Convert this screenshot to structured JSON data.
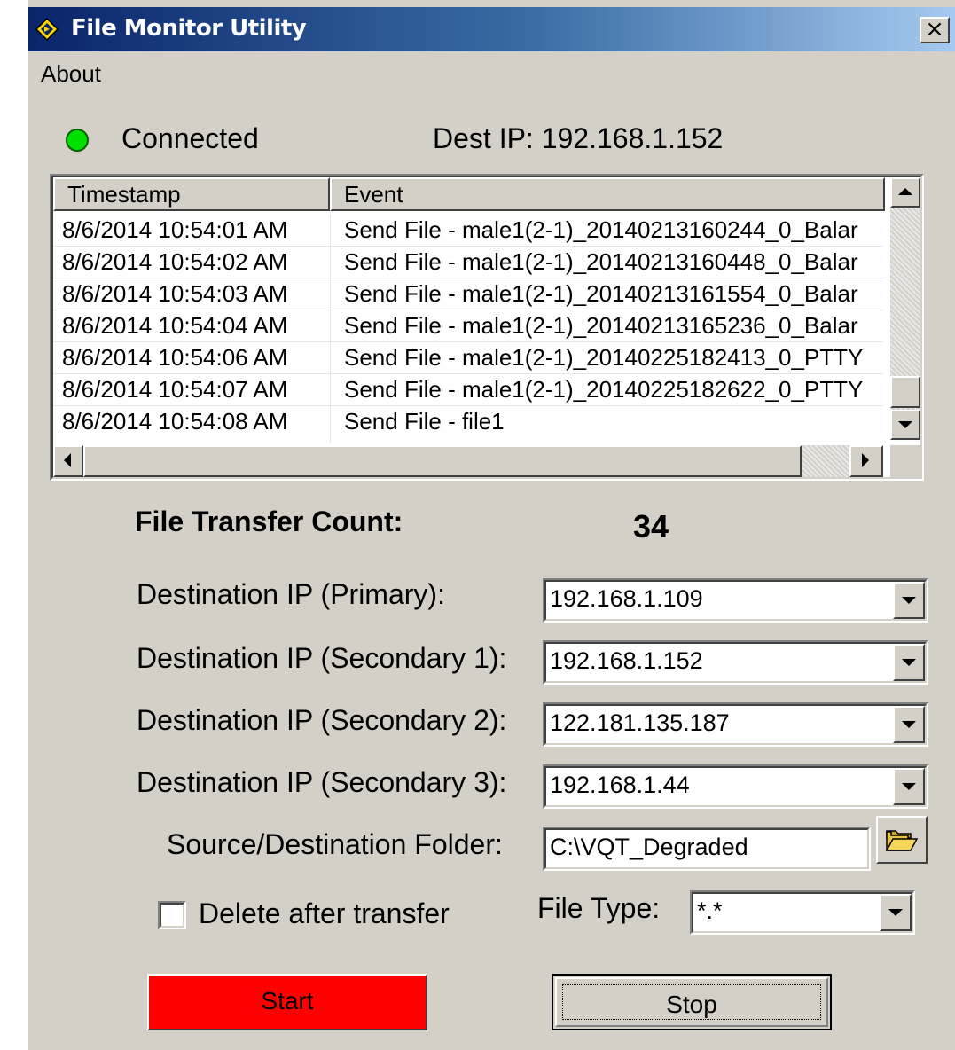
{
  "window": {
    "title": "File Monitor Utility",
    "close_label": "×"
  },
  "menu": {
    "about": "About"
  },
  "status": {
    "text": "Connected",
    "color": "#00e000",
    "dest_ip_label": "Dest IP: 192.168.1.152"
  },
  "event_log": {
    "columns": [
      "Timestamp",
      "Event"
    ],
    "rows": [
      {
        "timestamp": "8/6/2014 10:54:01 AM",
        "event": "Send File - male1(2-1)_20140213160244_0_Balar"
      },
      {
        "timestamp": "8/6/2014 10:54:02 AM",
        "event": "Send File - male1(2-1)_20140213160448_0_Balar"
      },
      {
        "timestamp": "8/6/2014 10:54:03 AM",
        "event": "Send File - male1(2-1)_20140213161554_0_Balar"
      },
      {
        "timestamp": "8/6/2014 10:54:04 AM",
        "event": "Send File - male1(2-1)_20140213165236_0_Balar"
      },
      {
        "timestamp": "8/6/2014 10:54:06 AM",
        "event": "Send File - male1(2-1)_20140225182413_0_PTTY"
      },
      {
        "timestamp": "8/6/2014 10:54:07 AM",
        "event": "Send File - male1(2-1)_20140225182622_0_PTTY"
      },
      {
        "timestamp": "8/6/2014 10:54:08 AM",
        "event": "Send File - file1"
      }
    ]
  },
  "transfer": {
    "count_label": "File Transfer Count:",
    "count_value": "34"
  },
  "destinations": {
    "primary": {
      "label": "Destination IP (Primary):",
      "value": "192.168.1.109"
    },
    "secondary1": {
      "label": "Destination IP (Secondary 1):",
      "value": "192.168.1.152"
    },
    "secondary2": {
      "label": "Destination IP (Secondary 2):",
      "value": "122.181.135.187"
    },
    "secondary3": {
      "label": "Destination IP (Secondary 3):",
      "value": "192.168.1.44"
    }
  },
  "folder": {
    "label": "Source/Destination Folder:",
    "value": "C:\\VQT_Degraded"
  },
  "options": {
    "delete_label": "Delete after transfer",
    "delete_checked": false,
    "file_type_label": "File Type:",
    "file_type_value": "*.*"
  },
  "buttons": {
    "start": "Start",
    "start_color": "#ff0000",
    "stop": "Stop"
  }
}
